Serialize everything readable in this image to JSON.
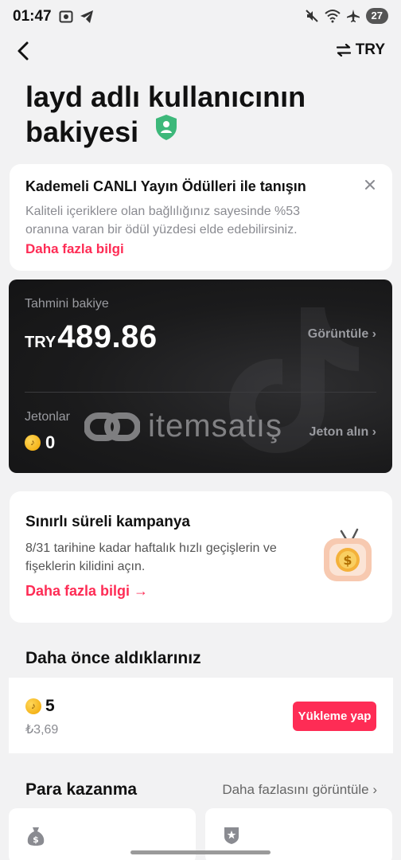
{
  "status_bar": {
    "time": "01:47",
    "battery": "27"
  },
  "nav": {
    "currency": "TRY"
  },
  "page": {
    "title": "layd adlı kullanıcının bakiyesi"
  },
  "promo": {
    "title": "Kademeli CANLI Yayın Ödülleri ile tanışın",
    "description": "Kaliteli içeriklere olan bağlılığınız sayesinde %53 oranına varan bir ödül yüzdesi elde edebilirsiniz.",
    "link": "Daha fazla bilgi"
  },
  "balance": {
    "label": "Tahmini bakiye",
    "currency": "TRY",
    "amount": "489.86",
    "view_label": "Görüntüle ›",
    "coins_label": "Jetonlar",
    "coins": "0",
    "get_coins_label": "Jeton alın ›",
    "watermark": "itemsatış"
  },
  "campaign": {
    "title": "Sınırlı süreli kampanya",
    "description": "8/31 tarihine kadar haftalık hızlı geçişlerin ve fişeklerin kilidini açın.",
    "link": "Daha fazla bilgi →"
  },
  "previous": {
    "title": "Daha önce aldıklarınız",
    "coins": "5",
    "price": "₺3,69",
    "button": "Yükleme yap"
  },
  "earn": {
    "title": "Para kazanma",
    "more_label": "Daha fazlasını görüntüle ›"
  },
  "colors": {
    "accent": "#fe2c55",
    "shield": "#3db87a"
  }
}
